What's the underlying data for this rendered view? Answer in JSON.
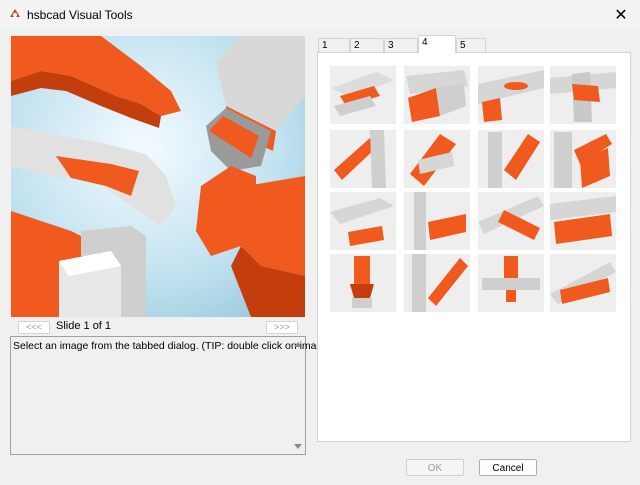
{
  "window": {
    "title": "hsbcad Visual Tools",
    "close_glyph": "✕"
  },
  "preview": {
    "nav_prev": "<<<",
    "nav_next": ">>>",
    "slide_label": "Slide 1 of 1",
    "accent": "#f05a1e"
  },
  "description": {
    "text": "Select an image from the tabbed dialog. (TIP: double click on image)"
  },
  "tabs": [
    {
      "label": "1"
    },
    {
      "label": "2"
    },
    {
      "label": "3"
    },
    {
      "label": "4"
    },
    {
      "label": "5"
    }
  ],
  "active_tab": "4",
  "thumbnails": [
    "thumb-1",
    "thumb-2",
    "thumb-3",
    "thumb-4",
    "thumb-5",
    "thumb-6",
    "thumb-7",
    "thumb-8",
    "thumb-9",
    "thumb-10",
    "thumb-11",
    "thumb-12",
    "thumb-13",
    "thumb-14",
    "thumb-15",
    "thumb-16"
  ],
  "buttons": {
    "ok": "OK",
    "cancel": "Cancel"
  }
}
